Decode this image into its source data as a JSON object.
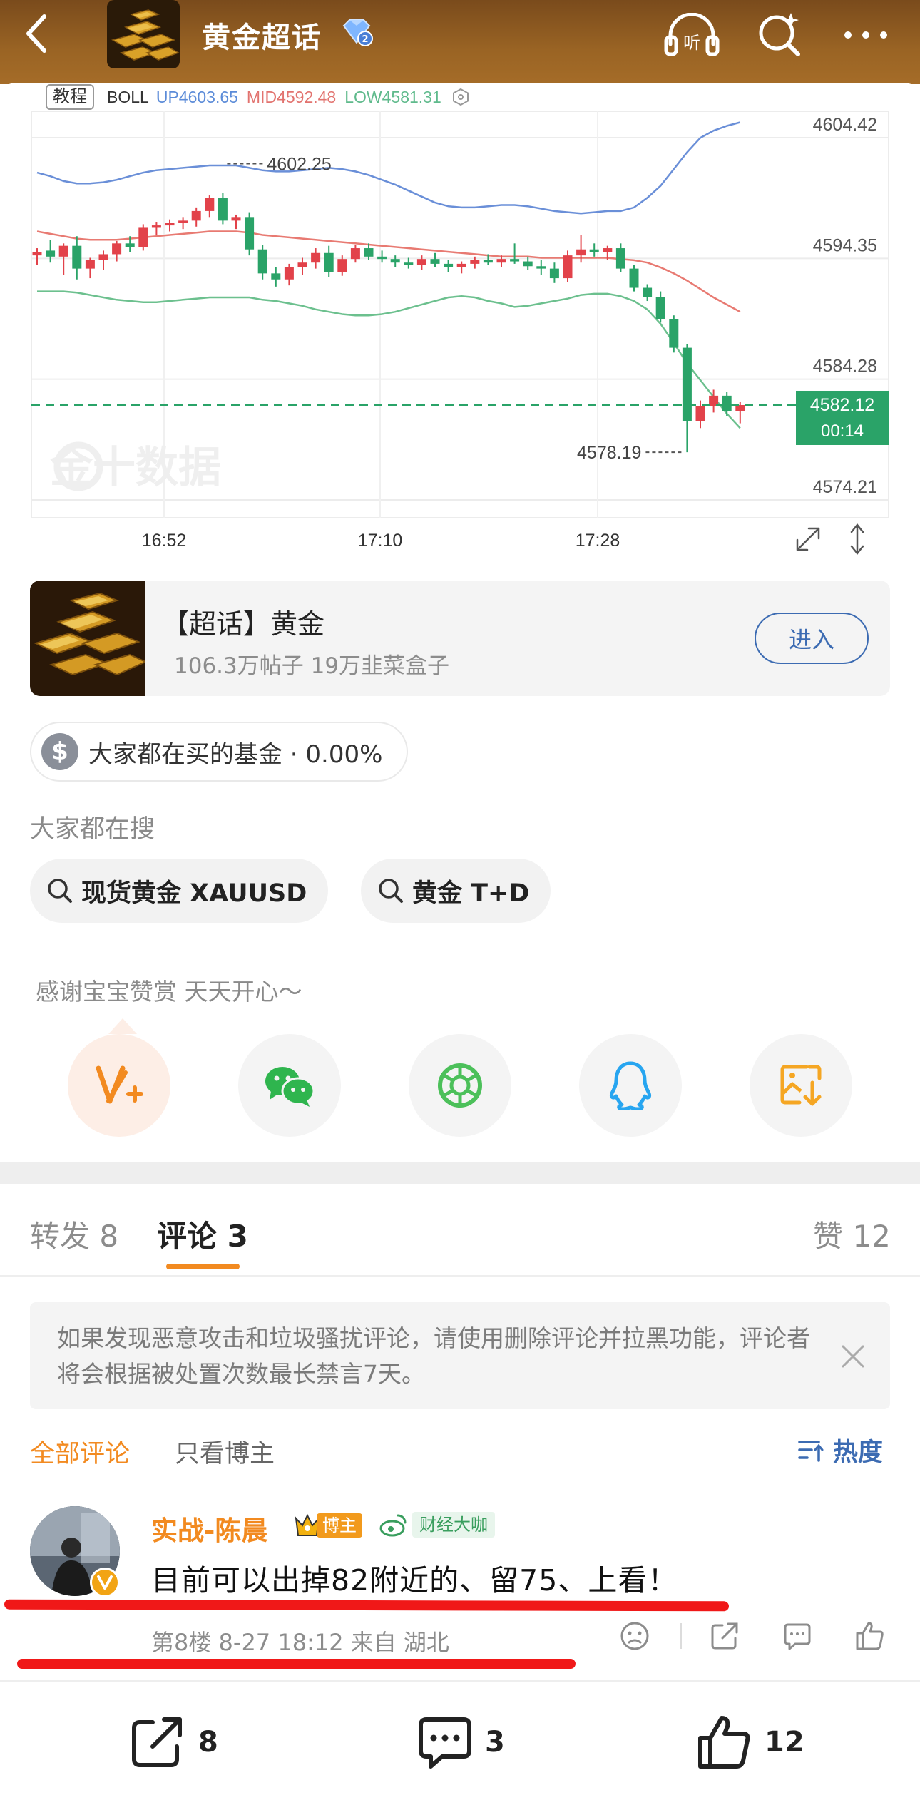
{
  "header": {
    "title": "黄金超话",
    "listen_icon_label": "听"
  },
  "chart": {
    "tag_tutorial": "教程",
    "boll_label": "BOLL",
    "boll_up": "UP4603.65",
    "boll_mid": "MID4592.48",
    "boll_low": "LOW4581.31",
    "watermark": "金十数据",
    "colors": {
      "up": "#e2424a",
      "down": "#2aa368",
      "upper_band": "#6a8fd8",
      "mid_band": "#e87a72",
      "lower_band": "#6cc08e",
      "current_price": "#2aa368"
    }
  },
  "chart_data": {
    "type": "candlestick",
    "indicator": "BOLL",
    "y_ticks": [
      "4604.42",
      "4594.35",
      "4584.28",
      "4574.21"
    ],
    "x_ticks": [
      "16:52",
      "17:10",
      "17:28"
    ],
    "annotations": {
      "high_label": "4602.25",
      "low_label": "4578.19"
    },
    "current_price": "4582.12",
    "countdown": "00:14",
    "ylim": [
      4574.21,
      4604.42
    ],
    "candles": [
      {
        "o": 4594.6,
        "h": 4595.2,
        "l": 4593.8,
        "c": 4594.9
      },
      {
        "o": 4595.0,
        "h": 4595.9,
        "l": 4594.0,
        "c": 4594.5
      },
      {
        "o": 4594.5,
        "h": 4595.6,
        "l": 4593.0,
        "c": 4595.4
      },
      {
        "o": 4595.4,
        "h": 4596.2,
        "l": 4592.6,
        "c": 4593.5
      },
      {
        "o": 4593.5,
        "h": 4594.4,
        "l": 4592.7,
        "c": 4594.2
      },
      {
        "o": 4594.2,
        "h": 4595.0,
        "l": 4593.4,
        "c": 4594.7
      },
      {
        "o": 4594.7,
        "h": 4595.8,
        "l": 4594.1,
        "c": 4595.6
      },
      {
        "o": 4595.6,
        "h": 4596.2,
        "l": 4594.9,
        "c": 4595.3
      },
      {
        "o": 4595.3,
        "h": 4597.2,
        "l": 4595.0,
        "c": 4596.9
      },
      {
        "o": 4596.9,
        "h": 4597.4,
        "l": 4596.3,
        "c": 4597.1
      },
      {
        "o": 4597.1,
        "h": 4597.6,
        "l": 4596.6,
        "c": 4597.3
      },
      {
        "o": 4597.3,
        "h": 4597.8,
        "l": 4596.8,
        "c": 4597.5
      },
      {
        "o": 4597.5,
        "h": 4598.6,
        "l": 4597.0,
        "c": 4598.3
      },
      {
        "o": 4598.3,
        "h": 4599.6,
        "l": 4597.8,
        "c": 4599.4
      },
      {
        "o": 4599.4,
        "h": 4599.8,
        "l": 4597.2,
        "c": 4597.5
      },
      {
        "o": 4597.5,
        "h": 4598.0,
        "l": 4596.8,
        "c": 4597.8
      },
      {
        "o": 4597.8,
        "h": 4598.2,
        "l": 4594.6,
        "c": 4595.1
      },
      {
        "o": 4595.1,
        "h": 4595.5,
        "l": 4592.6,
        "c": 4593.1
      },
      {
        "o": 4593.1,
        "h": 4593.6,
        "l": 4592.0,
        "c": 4592.6
      },
      {
        "o": 4592.6,
        "h": 4593.9,
        "l": 4592.1,
        "c": 4593.6
      },
      {
        "o": 4593.6,
        "h": 4594.4,
        "l": 4593.0,
        "c": 4594.0
      },
      {
        "o": 4594.0,
        "h": 4595.2,
        "l": 4593.5,
        "c": 4594.8
      },
      {
        "o": 4594.8,
        "h": 4595.4,
        "l": 4592.8,
        "c": 4593.2
      },
      {
        "o": 4593.2,
        "h": 4594.6,
        "l": 4592.9,
        "c": 4594.3
      },
      {
        "o": 4594.3,
        "h": 4595.5,
        "l": 4594.0,
        "c": 4595.2
      },
      {
        "o": 4595.2,
        "h": 4595.6,
        "l": 4594.2,
        "c": 4594.5
      },
      {
        "o": 4594.5,
        "h": 4595.0,
        "l": 4594.0,
        "c": 4594.3
      },
      {
        "o": 4594.3,
        "h": 4594.6,
        "l": 4593.6,
        "c": 4594.0
      },
      {
        "o": 4594.0,
        "h": 4594.4,
        "l": 4593.5,
        "c": 4593.8
      },
      {
        "o": 4593.8,
        "h": 4594.6,
        "l": 4593.4,
        "c": 4594.3
      },
      {
        "o": 4594.3,
        "h": 4594.8,
        "l": 4593.6,
        "c": 4593.9
      },
      {
        "o": 4593.9,
        "h": 4594.2,
        "l": 4593.2,
        "c": 4593.6
      },
      {
        "o": 4593.6,
        "h": 4594.1,
        "l": 4593.1,
        "c": 4593.9
      },
      {
        "o": 4593.9,
        "h": 4594.5,
        "l": 4593.5,
        "c": 4594.2
      },
      {
        "o": 4594.2,
        "h": 4594.7,
        "l": 4593.8,
        "c": 4594.0
      },
      {
        "o": 4594.0,
        "h": 4594.6,
        "l": 4593.6,
        "c": 4594.3
      },
      {
        "o": 4594.3,
        "h": 4595.6,
        "l": 4593.9,
        "c": 4594.1
      },
      {
        "o": 4594.1,
        "h": 4594.5,
        "l": 4593.4,
        "c": 4593.7
      },
      {
        "o": 4593.7,
        "h": 4594.2,
        "l": 4593.0,
        "c": 4593.5
      },
      {
        "o": 4593.5,
        "h": 4594.0,
        "l": 4592.3,
        "c": 4592.7
      },
      {
        "o": 4592.7,
        "h": 4595.0,
        "l": 4592.4,
        "c": 4594.6
      },
      {
        "o": 4594.6,
        "h": 4596.3,
        "l": 4594.0,
        "c": 4595.1
      },
      {
        "o": 4595.1,
        "h": 4595.6,
        "l": 4594.5,
        "c": 4594.9
      },
      {
        "o": 4594.9,
        "h": 4595.4,
        "l": 4594.2,
        "c": 4595.2
      },
      {
        "o": 4595.2,
        "h": 4595.6,
        "l": 4593.2,
        "c": 4593.5
      },
      {
        "o": 4593.5,
        "h": 4593.8,
        "l": 4591.6,
        "c": 4591.9
      },
      {
        "o": 4591.9,
        "h": 4592.2,
        "l": 4590.8,
        "c": 4591.1
      },
      {
        "o": 4591.1,
        "h": 4591.6,
        "l": 4589.0,
        "c": 4589.3
      },
      {
        "o": 4589.3,
        "h": 4589.6,
        "l": 4586.5,
        "c": 4586.9
      },
      {
        "o": 4586.9,
        "h": 4587.2,
        "l": 4578.19,
        "c": 4580.8
      },
      {
        "o": 4580.8,
        "h": 4582.5,
        "l": 4580.2,
        "c": 4582.0
      },
      {
        "o": 4582.0,
        "h": 4583.4,
        "l": 4581.5,
        "c": 4582.9
      },
      {
        "o": 4582.9,
        "h": 4583.2,
        "l": 4581.2,
        "c": 4581.6
      },
      {
        "o": 4581.6,
        "h": 4582.4,
        "l": 4580.6,
        "c": 4582.12
      }
    ],
    "upper_band": [
      4601.5,
      4601.2,
      4600.8,
      4600.6,
      4600.6,
      4600.7,
      4600.9,
      4601.2,
      4601.5,
      4601.7,
      4601.8,
      4601.9,
      4602.0,
      4602.1,
      4602.1,
      4602.1,
      4601.9,
      4601.7,
      4601.6,
      4601.6,
      4601.7,
      4601.8,
      4601.9,
      4601.8,
      4601.6,
      4601.3,
      4600.9,
      4600.5,
      4600.0,
      4599.5,
      4599.0,
      4598.7,
      4598.6,
      4598.6,
      4598.7,
      4598.8,
      4598.8,
      4598.7,
      4598.5,
      4598.3,
      4598.2,
      4598.1,
      4598.2,
      4598.3,
      4598.3,
      4598.6,
      4599.4,
      4600.4,
      4601.8,
      4603.2,
      4604.4,
      4605.0,
      4605.4,
      4605.7
    ],
    "mid_band": [
      4596.6,
      4596.4,
      4596.2,
      4596.0,
      4595.9,
      4595.9,
      4595.9,
      4596.0,
      4596.1,
      4596.2,
      4596.3,
      4596.4,
      4596.5,
      4596.6,
      4596.6,
      4596.6,
      4596.5,
      4596.3,
      4596.2,
      4596.1,
      4596.0,
      4595.9,
      4595.8,
      4595.7,
      4595.6,
      4595.5,
      4595.4,
      4595.3,
      4595.2,
      4595.1,
      4595.0,
      4594.9,
      4594.8,
      4594.7,
      4594.6,
      4594.5,
      4594.5,
      4594.5,
      4594.4,
      4594.4,
      4594.4,
      4594.4,
      4594.4,
      4594.4,
      4594.3,
      4594.2,
      4594.0,
      4593.6,
      4593.1,
      4592.5,
      4591.8,
      4591.1,
      4590.5,
      4589.9
    ],
    "lower_band": [
      4591.6,
      4591.6,
      4591.6,
      4591.5,
      4591.3,
      4591.1,
      4590.9,
      4590.8,
      4590.7,
      4590.7,
      4590.8,
      4590.9,
      4591.0,
      4591.1,
      4591.1,
      4591.1,
      4591.1,
      4590.9,
      4590.8,
      4590.6,
      4590.4,
      4590.1,
      4589.9,
      4589.7,
      4589.6,
      4589.6,
      4589.7,
      4589.9,
      4590.2,
      4590.5,
      4590.8,
      4591.1,
      4591.2,
      4591.1,
      4590.8,
      4590.6,
      4590.3,
      4590.4,
      4590.6,
      4590.8,
      4591.0,
      4591.3,
      4591.4,
      4591.4,
      4591.2,
      4590.8,
      4590.1,
      4588.9,
      4587.3,
      4585.6,
      4584.2,
      4582.8,
      4581.4,
      4580.2
    ]
  },
  "topic": {
    "title": "【超话】黄金",
    "subtitle": "106.3万帖子 19万韭菜盒子",
    "enter_label": "进入"
  },
  "fund": {
    "text": "大家都在买的基金 · 0.00%",
    "icon": "$"
  },
  "search": {
    "heading": "大家都在搜",
    "chips": [
      "现货黄金 XAUUSD",
      "黄金 T+D"
    ]
  },
  "thanks_text": "感谢宝宝赞赏 天天开心～",
  "share": {
    "icons": [
      "reward-icon",
      "wechat-icon",
      "moments-icon",
      "qq-icon",
      "save-image-icon"
    ],
    "colors": {
      "reward": "#f28a20",
      "wechat": "#2fb54e",
      "moments": "#4cc05a",
      "qq": "#27a5f0",
      "save": "#f5a623"
    }
  },
  "tabs": {
    "repost": "转发 8",
    "comment": "评论 3",
    "like": "赞 12"
  },
  "notice": {
    "text": "如果发现恶意攻击和垃圾骚扰评论，请使用删除评论并拉黑功能，评论者将会根据被处置次数最长禁言7天。"
  },
  "filter": {
    "all": "全部评论",
    "owner_only": "只看博主",
    "sort": "热度"
  },
  "comment": {
    "name": "实战-陈晨",
    "owner_tag": "博主",
    "expert_tag": "财经大咖",
    "text": "目前可以出掉82附近的、留75、上看！",
    "meta": "第8楼  8-27 18:12  来自 湖北"
  },
  "bottom_bar": {
    "repost_count": "8",
    "comment_count": "3",
    "like_count": "12"
  }
}
